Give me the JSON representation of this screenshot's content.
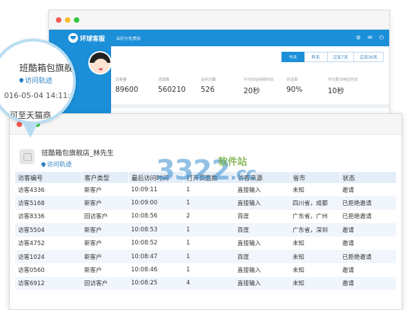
{
  "back_window": {
    "logo": "环球客服",
    "subtitle": "当前为免费版",
    "icons": [
      "gear-icon",
      "chat-icon",
      "power-icon"
    ],
    "tabs": [
      {
        "label": "今天",
        "active": true
      },
      {
        "label": "昨天",
        "active": false
      },
      {
        "label": "过去7天",
        "active": false
      },
      {
        "label": "过去30天",
        "active": false
      }
    ],
    "stats": [
      {
        "label": "访客量",
        "value": "89600"
      },
      {
        "label": "消息数",
        "value": "560210"
      },
      {
        "label": "访问次数",
        "value": "526"
      },
      {
        "label": "平均对话持续时长",
        "value": "20秒"
      },
      {
        "label": "对话率",
        "value": "90%"
      },
      {
        "label": "平均首次响应时长",
        "value": "10秒"
      }
    ]
  },
  "bubble": {
    "name": "班酷箱包旗舰",
    "link": "访问轨迹",
    "time": "016-05-04 14:11:03",
    "text": "可至天猫商"
  },
  "front_window": {
    "visitor_name": "班酷箱包旗舰店_林先生",
    "visitor_link": "访问轨迹",
    "table": {
      "headers": [
        "访客编号",
        "客户类型",
        "最后访问时间",
        "打开页面数",
        "访客来源",
        "省市",
        "状态"
      ],
      "rows": [
        {
          "id": "访客4336",
          "type": "新客户",
          "time": "10:09:11",
          "pages": "1",
          "source": "直接输入",
          "region": "未知",
          "status": "邀请",
          "rejected": false
        },
        {
          "id": "访客5168",
          "type": "新客户",
          "time": "10:09:00",
          "pages": "1",
          "source": "直接输入",
          "region": "四川省，成都",
          "status": "已拒绝邀请",
          "rejected": true
        },
        {
          "id": "访客8336",
          "type": "回访客户",
          "time": "10:08:56",
          "pages": "2",
          "source": "百度",
          "region": "广东省，广州",
          "status": "已拒绝邀请",
          "rejected": true
        },
        {
          "id": "访客5504",
          "type": "新客户",
          "time": "10:08:53",
          "pages": "1",
          "source": "百度",
          "region": "广东省，深圳",
          "status": "邀请",
          "rejected": false
        },
        {
          "id": "访客4752",
          "type": "新客户",
          "time": "10:08:52",
          "pages": "1",
          "source": "直接输入",
          "region": "未知",
          "status": "邀请",
          "rejected": false
        },
        {
          "id": "访客1024",
          "type": "新客户",
          "time": "10:08:47",
          "pages": "1",
          "source": "百度",
          "region": "未知",
          "status": "已拒绝邀请",
          "rejected": true
        },
        {
          "id": "访客0560",
          "type": "新客户",
          "time": "10:08:46",
          "pages": "1",
          "source": "直接输入",
          "region": "未知",
          "status": "邀请",
          "rejected": false
        },
        {
          "id": "访客6912",
          "type": "回访客户",
          "time": "10:08:25",
          "pages": "4",
          "source": "直接输入",
          "region": "未知",
          "status": "邀请",
          "rejected": false
        }
      ]
    }
  },
  "watermark": {
    "main": "3322",
    "sub": "软件站",
    "domain": ".cc"
  },
  "colors": {
    "primary": "#1b8fd8",
    "link": "#2b7fc3",
    "rejected": "#9a9a9a",
    "header_bg": "#e4eef8"
  }
}
